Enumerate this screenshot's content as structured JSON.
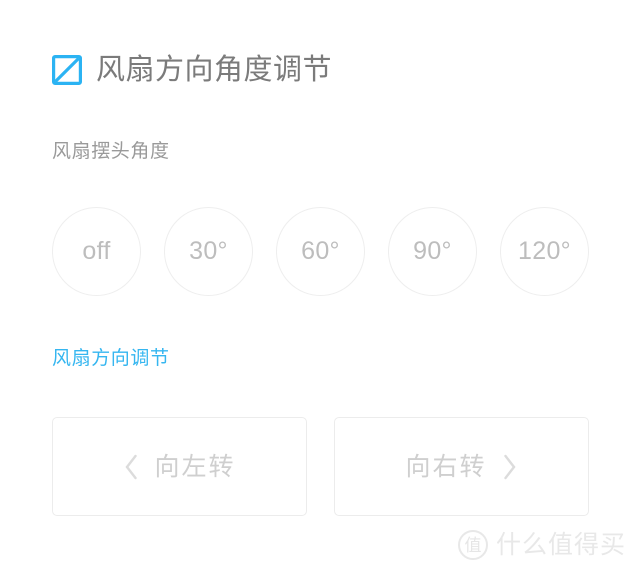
{
  "header": {
    "icon": "blue-square-slash-icon",
    "title": "风扇方向角度调节",
    "icon_color": "#2bb3f3"
  },
  "oscillation": {
    "section_label": "风扇摆头角度",
    "options": [
      {
        "id": "off",
        "label": "off",
        "selected": false
      },
      {
        "id": "30",
        "label": "30°",
        "selected": false
      },
      {
        "id": "60",
        "label": "60°",
        "selected": false
      },
      {
        "id": "90",
        "label": "90°",
        "selected": false
      },
      {
        "id": "120",
        "label": "120°",
        "selected": false
      }
    ]
  },
  "direction": {
    "link_label": "风扇方向调节",
    "link_color": "#35b6f0",
    "buttons": [
      {
        "id": "turn-left",
        "label": "向左转",
        "icon": "chevron-left-icon",
        "icon_side": "left"
      },
      {
        "id": "turn-right",
        "label": "向右转",
        "icon": "chevron-right-icon",
        "icon_side": "right"
      }
    ]
  },
  "watermark": {
    "badge": "值",
    "text": "什么值得买"
  },
  "theme": {
    "background": "#ffffff",
    "title_color": "#7b7b7b",
    "label_color": "#9a9a9a",
    "border_color": "#eeeeee",
    "muted_text": "#bdbdbd"
  }
}
